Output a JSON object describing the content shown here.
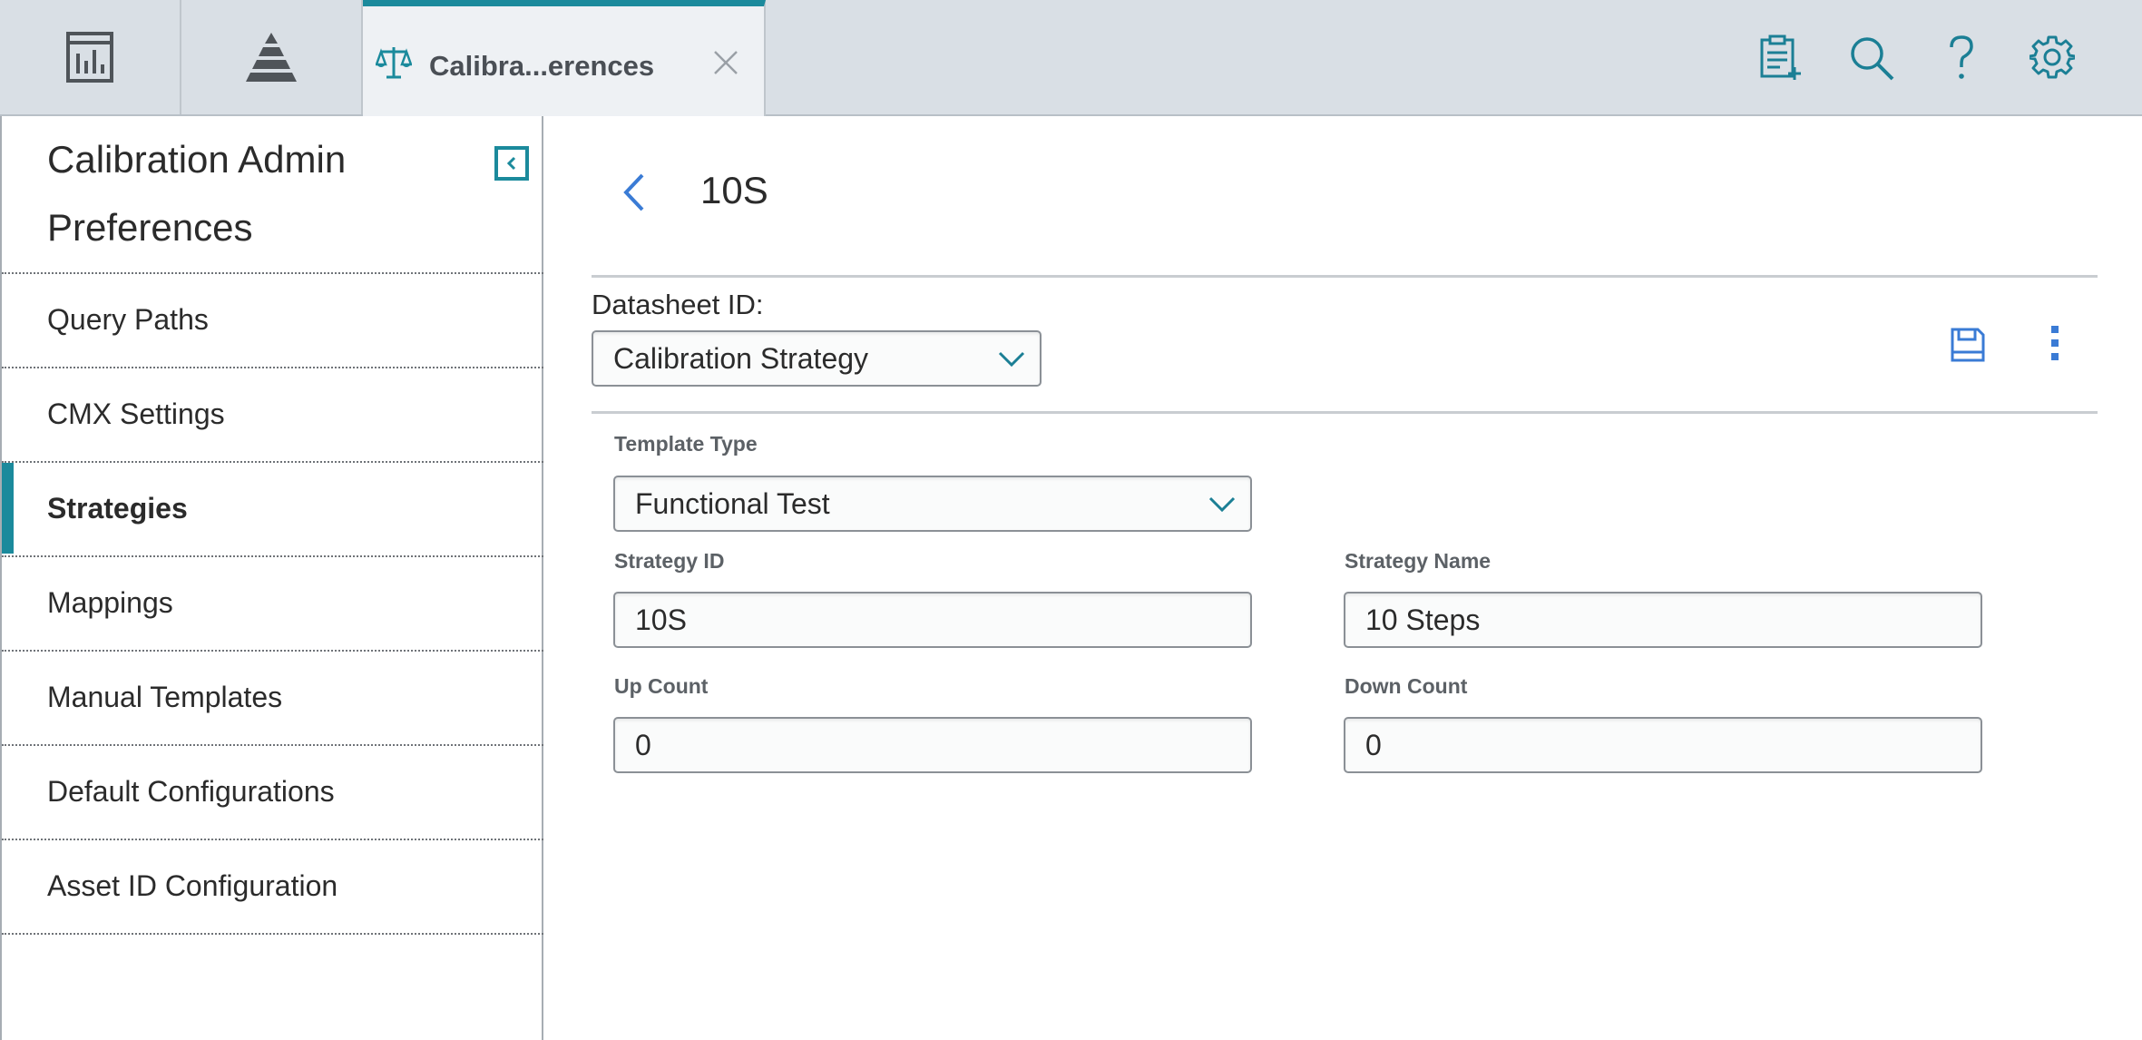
{
  "colors": {
    "accent": "#1b8a9c",
    "link_blue": "#3a7bd5",
    "topbar_bg": "#d9dfe5"
  },
  "topbar": {
    "left_icons": [
      "dashboard-icon",
      "pyramid-icon"
    ],
    "active_tab": {
      "icon": "scales-icon",
      "title": "Calibra...erences"
    },
    "right_icons": [
      "clipboard-add-icon",
      "search-icon",
      "help-icon",
      "gear-icon"
    ]
  },
  "sidebar": {
    "title": "Calibration Admin Preferences",
    "items": [
      {
        "label": "Query Paths"
      },
      {
        "label": "CMX Settings"
      },
      {
        "label": "Strategies",
        "active": true
      },
      {
        "label": "Mappings"
      },
      {
        "label": "Manual Templates"
      },
      {
        "label": "Default Configurations"
      },
      {
        "label": "Asset ID Configuration"
      }
    ]
  },
  "main": {
    "record_title": "10S",
    "datasheet": {
      "label": "Datasheet ID:",
      "value": "Calibration Strategy"
    },
    "fields": {
      "template_type": {
        "label": "Template Type",
        "value": "Functional Test"
      },
      "strategy_id": {
        "label": "Strategy ID",
        "value": "10S"
      },
      "strategy_name": {
        "label": "Strategy Name",
        "value": "10 Steps"
      },
      "up_count": {
        "label": "Up Count",
        "value": "0"
      },
      "down_count": {
        "label": "Down Count",
        "value": "0"
      }
    }
  }
}
